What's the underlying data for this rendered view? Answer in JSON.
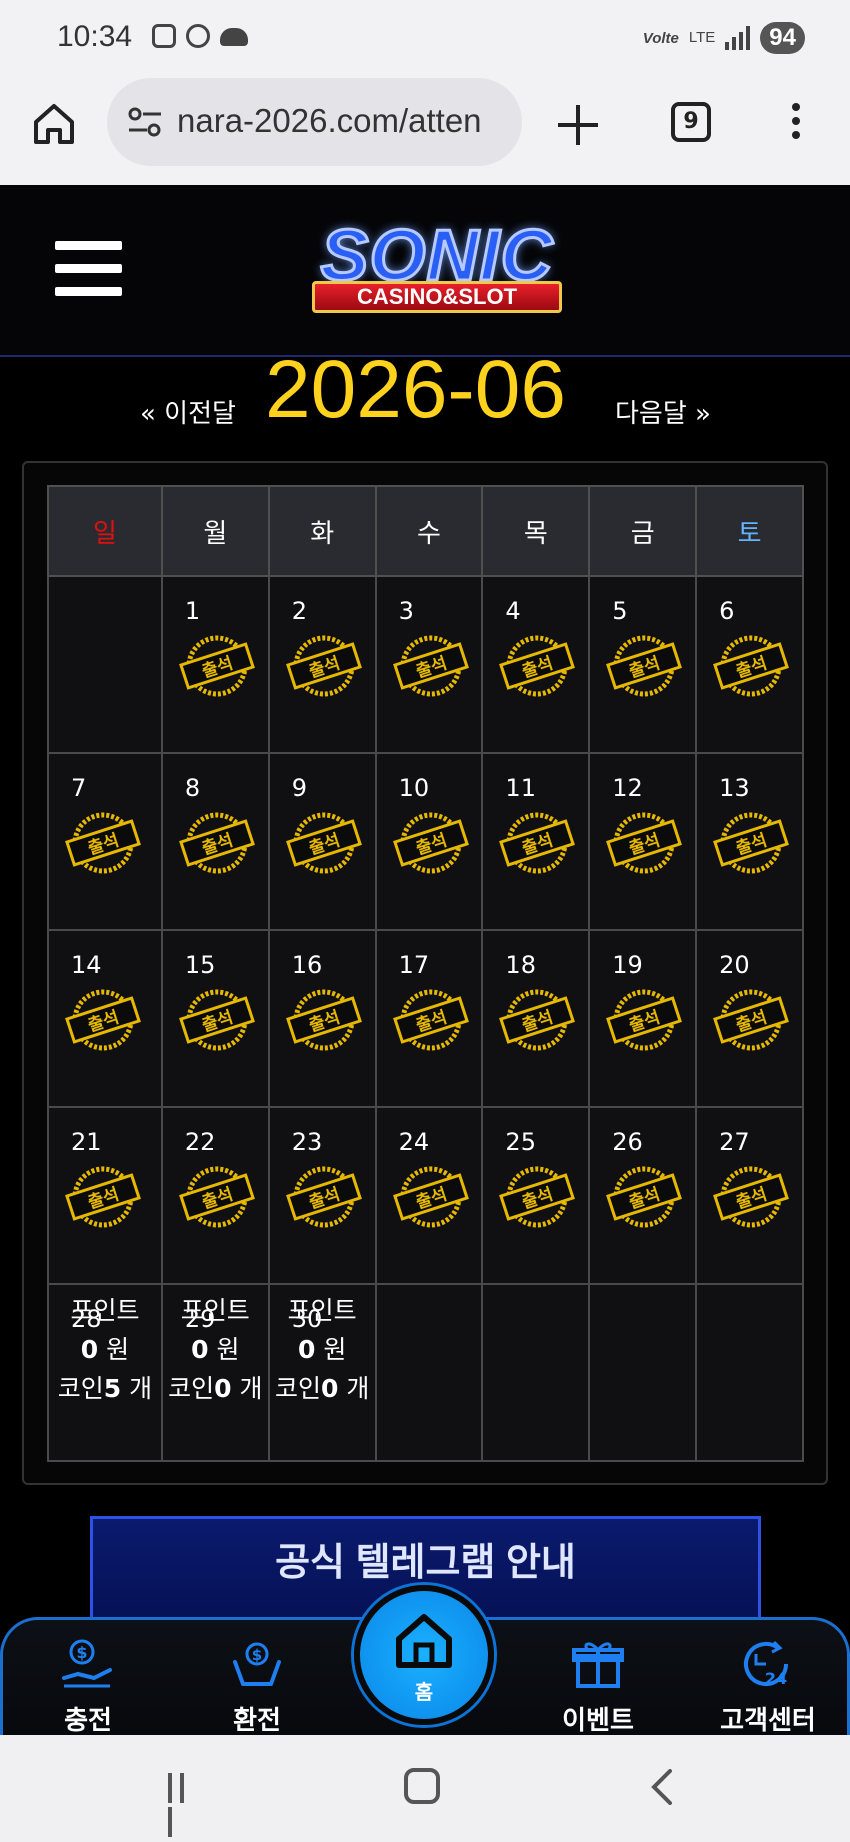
{
  "status_bar": {
    "time": "10:34",
    "volte": "Volte",
    "network": "LTE",
    "battery": "94"
  },
  "browser": {
    "url": "nara-2026.com/atten",
    "tab_count": "9"
  },
  "site": {
    "logo_main": "SONIC",
    "logo_sub": "CASINO&SLOT"
  },
  "month_nav": {
    "prev": "« 이전달",
    "title": "2026-06",
    "next": "다음달 »"
  },
  "calendar": {
    "weekdays": [
      "일",
      "월",
      "화",
      "수",
      "목",
      "금",
      "토"
    ],
    "stamp_text": "출석",
    "days": [
      "1",
      "2",
      "3",
      "4",
      "5",
      "6",
      "7",
      "8",
      "9",
      "10",
      "11",
      "12",
      "13",
      "14",
      "15",
      "16",
      "17",
      "18",
      "19",
      "20",
      "21",
      "22",
      "23",
      "24",
      "25",
      "26",
      "27"
    ],
    "last_week": [
      {
        "day": "28",
        "points_label": "포인트",
        "points": "0",
        "won": "원",
        "coin_label": "코인",
        "coins": "5",
        "unit": "개"
      },
      {
        "day": "29",
        "points_label": "포인트",
        "points": "0",
        "won": "원",
        "coin_label": "코인",
        "coins": "0",
        "unit": "개"
      },
      {
        "day": "30",
        "points_label": "포인트",
        "points": "0",
        "won": "원",
        "coin_label": "코인",
        "coins": "0",
        "unit": "개"
      }
    ]
  },
  "banner": {
    "title": "공식 텔레그램 안내"
  },
  "bottom_nav": {
    "charge": "충전",
    "exchange": "환전",
    "home": "홈",
    "event": "이벤트",
    "support": "고객센터"
  },
  "colors": {
    "accent_gold": "#ffd21e",
    "sunday": "#e01010",
    "saturday": "#62b4ff",
    "nav_blue": "#1a6fcf"
  }
}
